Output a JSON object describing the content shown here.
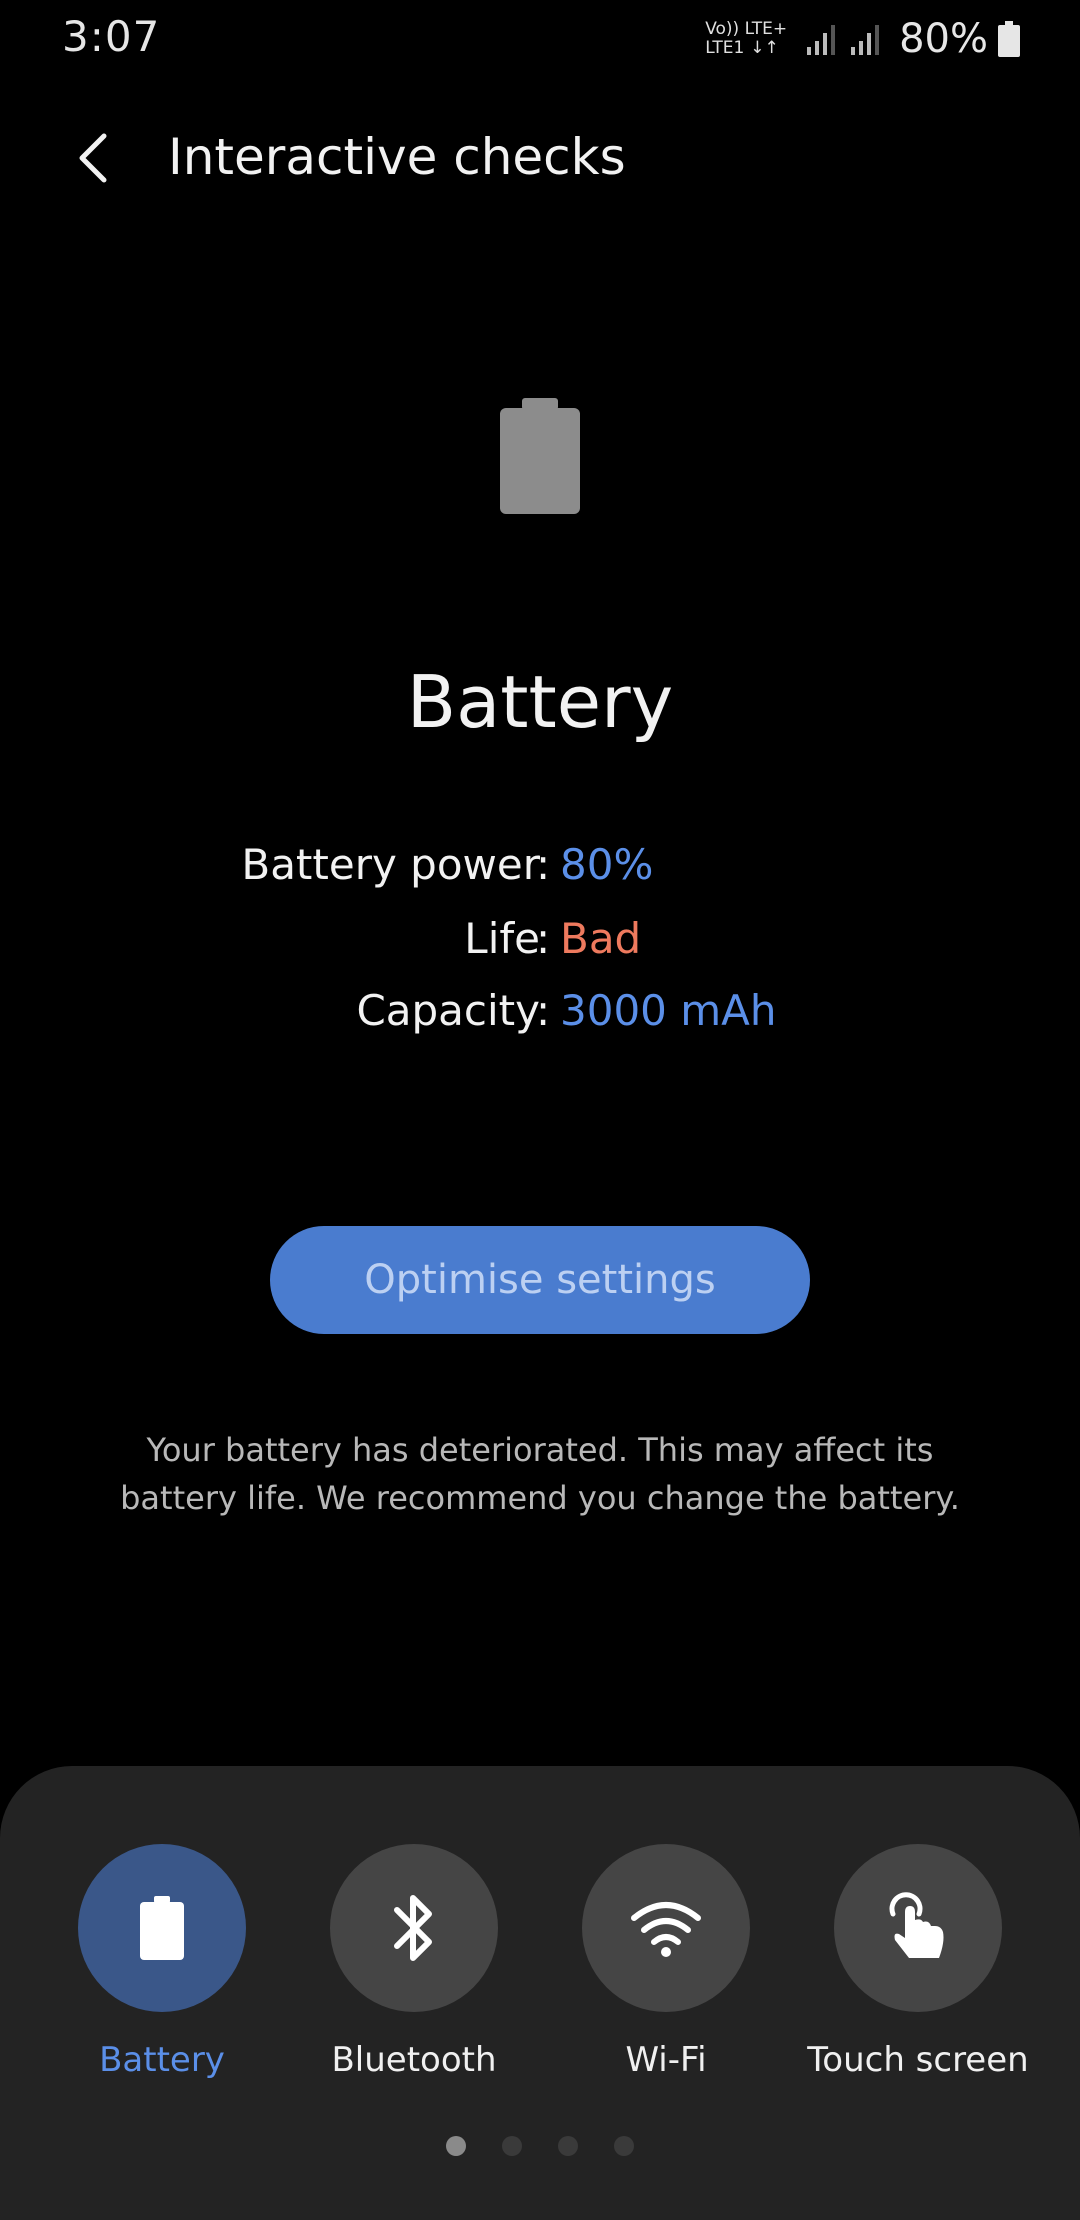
{
  "status_bar": {
    "time": "3:07",
    "network_top": "Vo)) LTE+",
    "network_bottom": "LTE1",
    "battery_percent": "80%",
    "battery_icon": "battery-icon",
    "signal_icon": "signal-icon"
  },
  "header": {
    "title": "Interactive checks",
    "back_icon": "chevron-left-icon"
  },
  "main": {
    "hero_icon": "battery-icon",
    "title": "Battery",
    "rows": [
      {
        "label": "Battery power",
        "colon": ":",
        "value": "80%",
        "value_color": "#5b8fe8"
      },
      {
        "label": "Life",
        "colon": ":",
        "value": "Bad",
        "value_color": "#ee7a5e"
      },
      {
        "label": "Capacity",
        "colon": ":",
        "value": "3000 mAh",
        "value_color": "#5b8fe8"
      }
    ],
    "button_label": "Optimise settings",
    "message": "Your battery has deteriorated. This may affect its battery life. We recommend you change the battery."
  },
  "checks": {
    "items": [
      {
        "label": "Battery",
        "icon": "battery-icon",
        "active": true
      },
      {
        "label": "Bluetooth",
        "icon": "bluetooth-icon",
        "active": false
      },
      {
        "label": "Wi-Fi",
        "icon": "wifi-icon",
        "active": false
      },
      {
        "label": "Touch screen",
        "icon": "touch-icon",
        "active": false
      }
    ],
    "page_count": 4,
    "current_page": 1
  },
  "colors": {
    "accent": "#5b8fe8",
    "warning": "#ee7a5e",
    "button": "#4a7ccf",
    "panel": "#232323"
  }
}
